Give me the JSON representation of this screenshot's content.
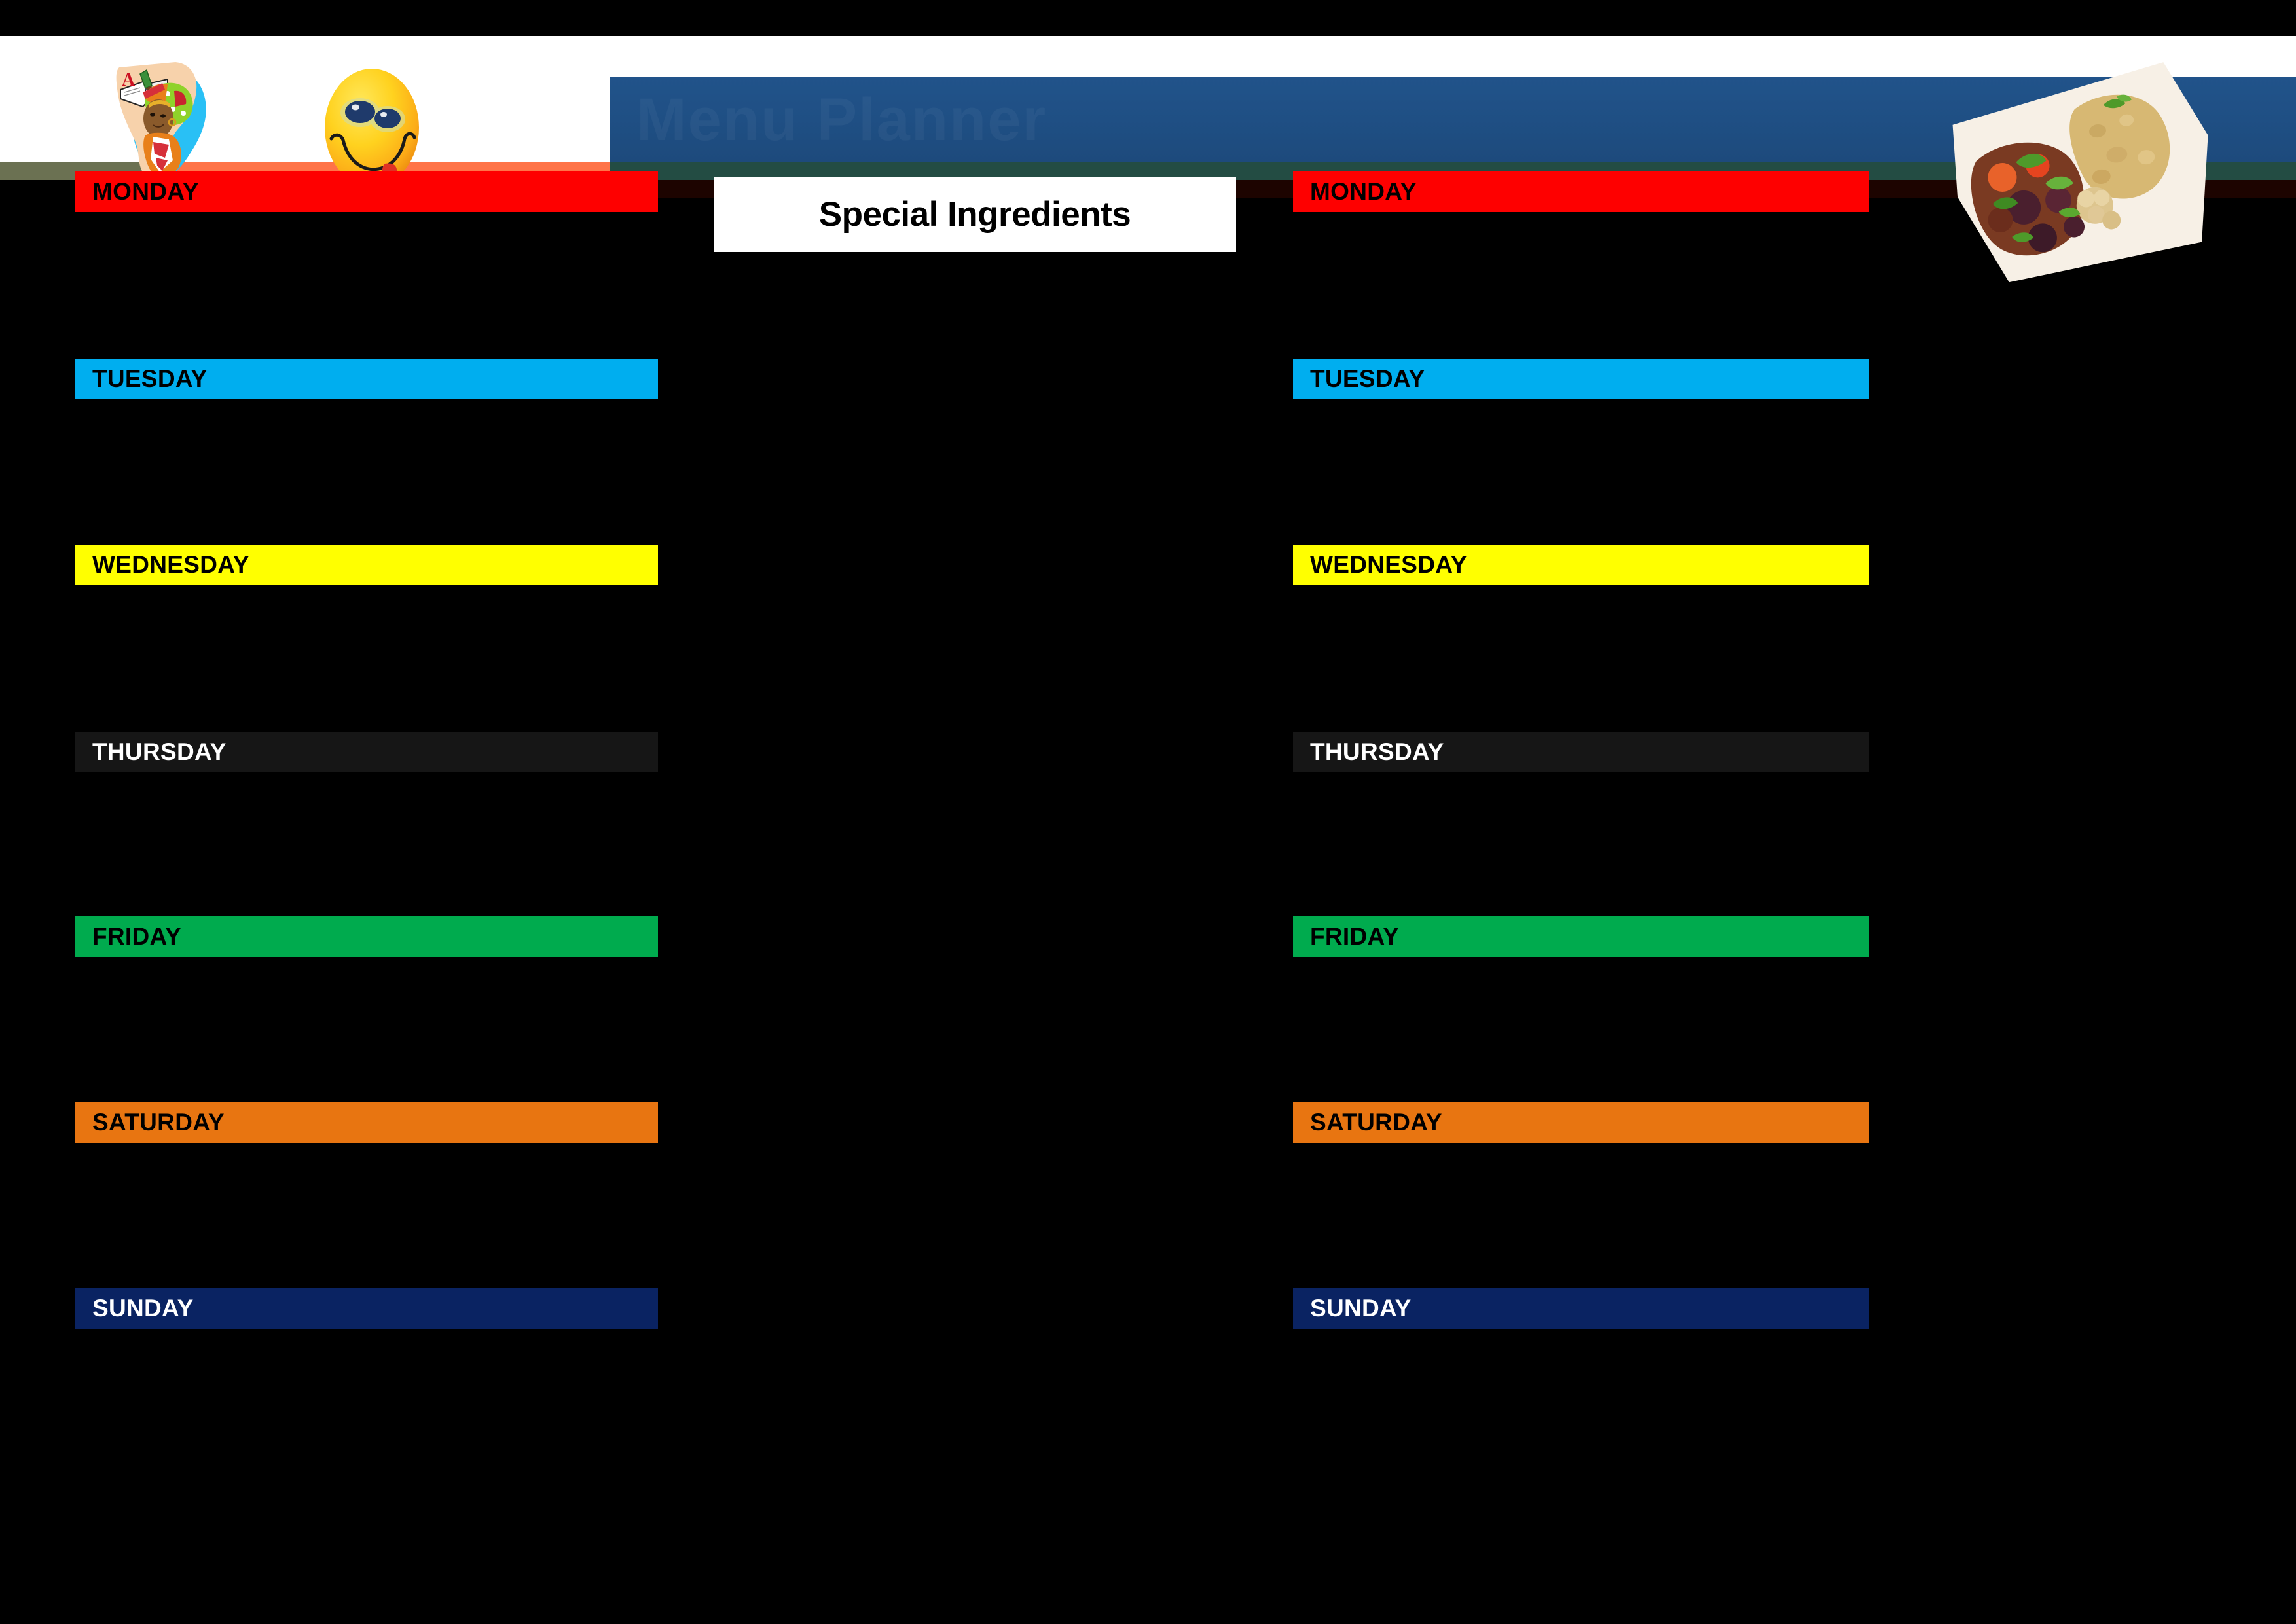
{
  "page": {
    "background_color": "#000000",
    "title_banner_text": "Menu Planner",
    "document_type": "weekly-meal-planner"
  },
  "header": {
    "clipart": [
      {
        "name": "africa-education-clipart",
        "description": "African woman with headwrap on Africa map with open book and pen"
      },
      {
        "name": "smiley-face-clipart",
        "description": "Yellow smiley face with tongue out"
      }
    ],
    "photo": {
      "name": "food-photo",
      "description": "Couscous with vegetable stew on a white plate"
    },
    "stripes": {
      "olive": "#6b7152",
      "green": "#1d5c3e",
      "salmon": "#ff7448",
      "teal": "#234c43",
      "red": "#fe0000",
      "dark_red": "#1d0400"
    },
    "banner_color": "#1f4f84"
  },
  "special_ingredients": {
    "label": "Special Ingredients",
    "box_color": "#ffffff",
    "text_color": "#000000"
  },
  "day_colors": {
    "monday": "#fe0000",
    "tuesday": "#00aeef",
    "wednesday": "#ffff00",
    "thursday": "#161616",
    "friday": "#00ab4e",
    "saturday": "#e87511",
    "sunday": "#0a2362"
  },
  "columns": [
    {
      "id": "left",
      "name": "week-one-column",
      "days": [
        {
          "label": "MONDAY",
          "color": "#fe0000",
          "text_color": "#000000",
          "entry": ""
        },
        {
          "label": "TUESDAY",
          "color": "#00aeef",
          "text_color": "#000000",
          "entry": ""
        },
        {
          "label": "WEDNESDAY",
          "color": "#ffff00",
          "text_color": "#000000",
          "entry": ""
        },
        {
          "label": "THURSDAY",
          "color": "#161616",
          "text_color": "#ffffff",
          "entry": ""
        },
        {
          "label": "FRIDAY",
          "color": "#00ab4e",
          "text_color": "#000000",
          "entry": ""
        },
        {
          "label": "SATURDAY",
          "color": "#e87511",
          "text_color": "#000000",
          "entry": ""
        },
        {
          "label": "SUNDAY",
          "color": "#0a2362",
          "text_color": "#ffffff",
          "entry": ""
        }
      ]
    },
    {
      "id": "right",
      "name": "week-two-column",
      "days": [
        {
          "label": "MONDAY",
          "color": "#fe0000",
          "text_color": "#000000",
          "entry": ""
        },
        {
          "label": "TUESDAY",
          "color": "#00aeef",
          "text_color": "#000000",
          "entry": ""
        },
        {
          "label": "WEDNESDAY",
          "color": "#ffff00",
          "text_color": "#000000",
          "entry": ""
        },
        {
          "label": "THURSDAY",
          "color": "#161616",
          "text_color": "#ffffff",
          "entry": ""
        },
        {
          "label": "FRIDAY",
          "color": "#00ab4e",
          "text_color": "#000000",
          "entry": ""
        },
        {
          "label": "SATURDAY",
          "color": "#e87511",
          "text_color": "#000000",
          "entry": ""
        },
        {
          "label": "SUNDAY",
          "color": "#0a2362",
          "text_color": "#ffffff",
          "entry": ""
        }
      ]
    }
  ]
}
